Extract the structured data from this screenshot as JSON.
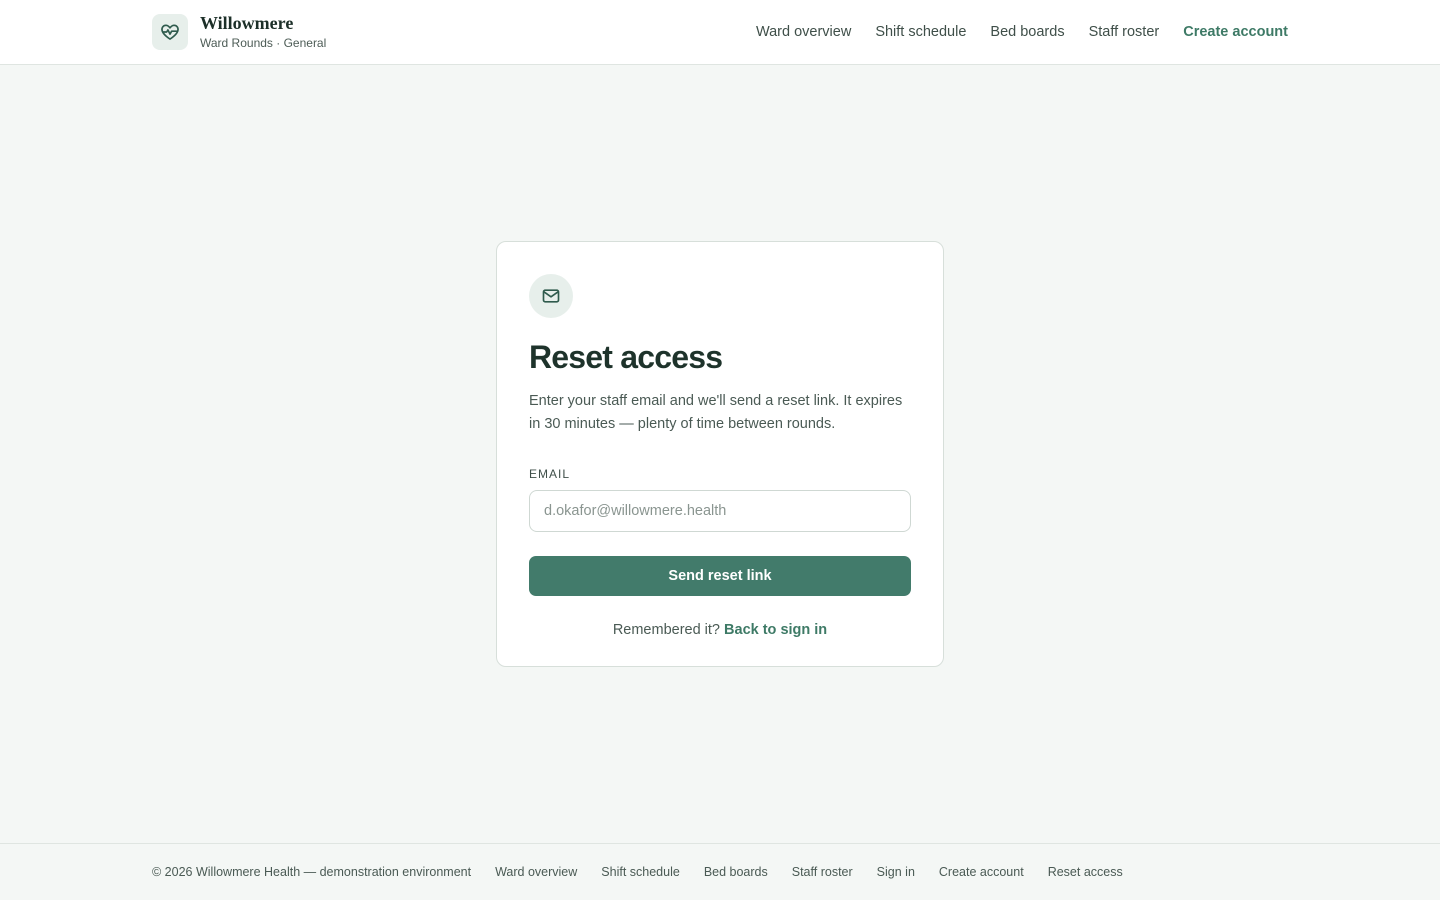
{
  "brand": {
    "name": "Willowmere",
    "subtitle": "Ward Rounds · General",
    "icon": "heart-pulse-icon",
    "accent_color": "#3e7a66"
  },
  "nav": {
    "items": [
      {
        "label": "Ward overview"
      },
      {
        "label": "Shift schedule"
      },
      {
        "label": "Bed boards"
      },
      {
        "label": "Staff roster"
      }
    ],
    "cta_label": "Create account"
  },
  "card": {
    "icon": "mail-icon",
    "title": "Reset access",
    "description": "Enter your staff email and we'll send a reset link. It expires in 30 minutes — plenty of time between rounds.",
    "email_label": "EMAIL",
    "email_placeholder": "d.okafor@willowmere.health",
    "email_value": "",
    "submit_label": "Send reset link",
    "submit_color": "#427b6b",
    "alt_prompt": "Remembered it?",
    "alt_link": "Back to sign in"
  },
  "footer": {
    "copyright": "© 2026 Willowmere Health — demonstration environment",
    "links": [
      {
        "label": "Ward overview"
      },
      {
        "label": "Shift schedule"
      },
      {
        "label": "Bed boards"
      },
      {
        "label": "Staff roster"
      },
      {
        "label": "Sign in"
      },
      {
        "label": "Create account"
      },
      {
        "label": "Reset access"
      }
    ]
  }
}
